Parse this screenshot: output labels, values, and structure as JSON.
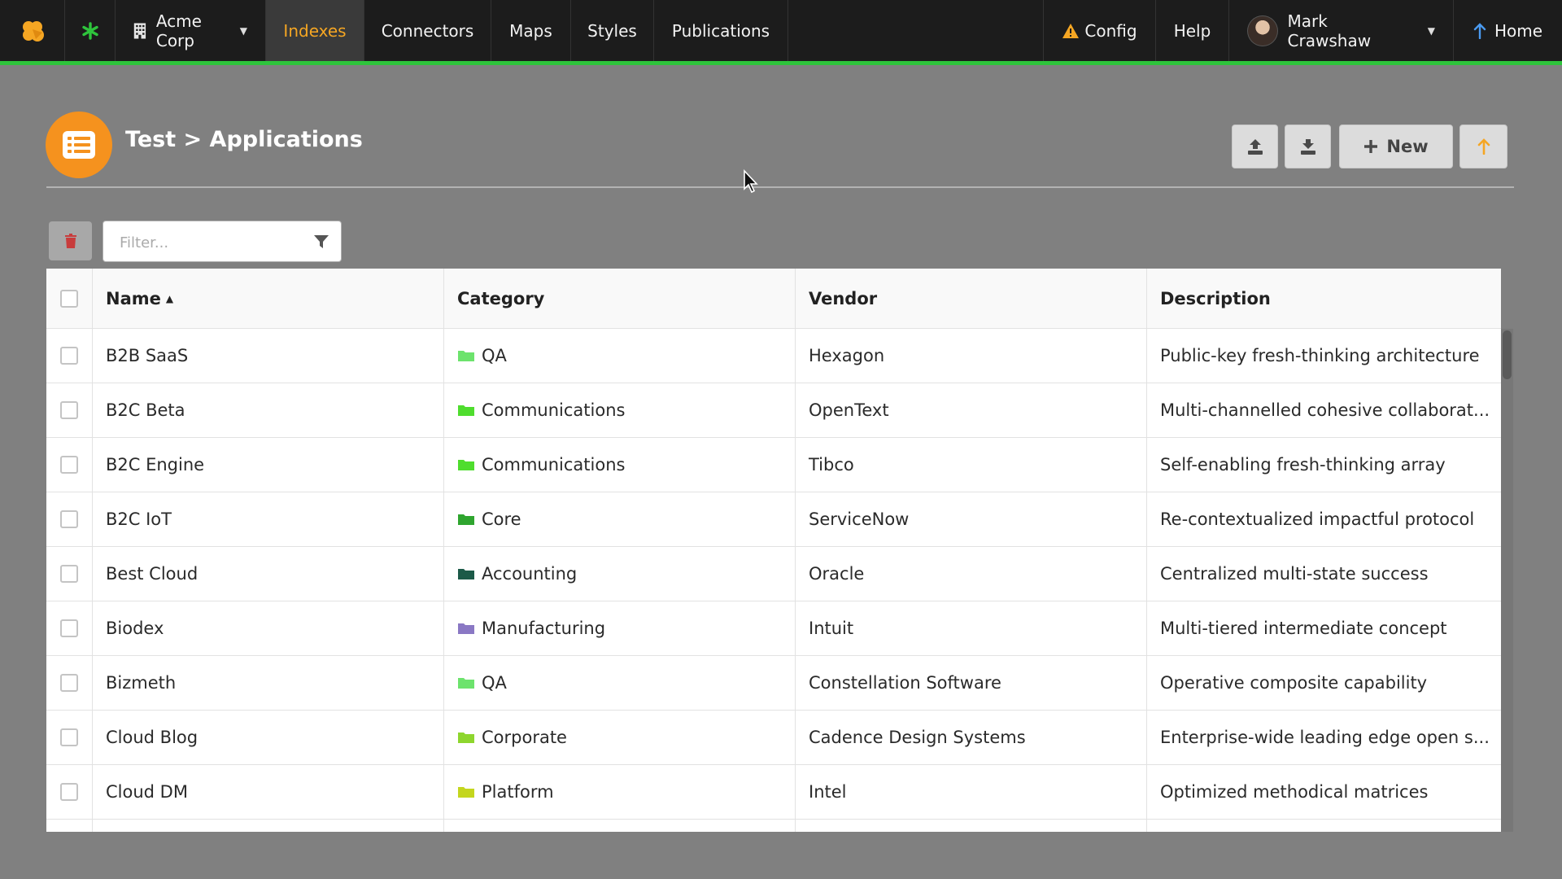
{
  "nav": {
    "org": "Acme Corp",
    "items": [
      {
        "label": "Indexes",
        "active": true
      },
      {
        "label": "Connectors",
        "active": false
      },
      {
        "label": "Maps",
        "active": false
      },
      {
        "label": "Styles",
        "active": false
      },
      {
        "label": "Publications",
        "active": false
      }
    ],
    "config": "Config",
    "help": "Help",
    "user": "Mark Crawshaw",
    "home": "Home"
  },
  "page": {
    "title": "Test > Applications",
    "new_button": "New"
  },
  "filter": {
    "placeholder": "Filter..."
  },
  "table": {
    "columns": [
      "Name",
      "Category",
      "Vendor",
      "Description"
    ],
    "sorted_column": "Name",
    "sort_direction": "ascending",
    "rows": [
      {
        "name": "B2B SaaS",
        "category": "QA",
        "category_color": "#6de36d",
        "vendor": "Hexagon",
        "description": "Public-key fresh-thinking architecture"
      },
      {
        "name": "B2C Beta",
        "category": "Communications",
        "category_color": "#4fdd2e",
        "vendor": "OpenText",
        "description": "Multi-channelled cohesive collaborat..."
      },
      {
        "name": "B2C Engine",
        "category": "Communications",
        "category_color": "#4fdd2e",
        "vendor": "Tibco",
        "description": "Self-enabling fresh-thinking array"
      },
      {
        "name": "B2C IoT",
        "category": "Core",
        "category_color": "#2fa52f",
        "vendor": "ServiceNow",
        "description": "Re-contextualized impactful protocol"
      },
      {
        "name": "Best Cloud",
        "category": "Accounting",
        "category_color": "#1c5a48",
        "vendor": "Oracle",
        "description": "Centralized multi-state success"
      },
      {
        "name": "Biodex",
        "category": "Manufacturing",
        "category_color": "#8a78c4",
        "vendor": "Intuit",
        "description": "Multi-tiered intermediate concept"
      },
      {
        "name": "Bizmeth",
        "category": "QA",
        "category_color": "#6de36d",
        "vendor": "Constellation Software",
        "description": "Operative composite capability"
      },
      {
        "name": "Cloud Blog",
        "category": "Corporate",
        "category_color": "#8ed62e",
        "vendor": "Cadence Design Systems",
        "description": "Enterprise-wide leading edge open s..."
      },
      {
        "name": "Cloud DM",
        "category": "Platform",
        "category_color": "#c4d61e",
        "vendor": "Intel",
        "description": "Optimized methodical matrices"
      }
    ]
  },
  "colors": {
    "nav_bg": "#1c1c1c",
    "nav_accent_line": "#2ec43c",
    "active_nav_text": "#f5a623",
    "page_icon": "#f5921e",
    "warning": "#f5a623"
  }
}
